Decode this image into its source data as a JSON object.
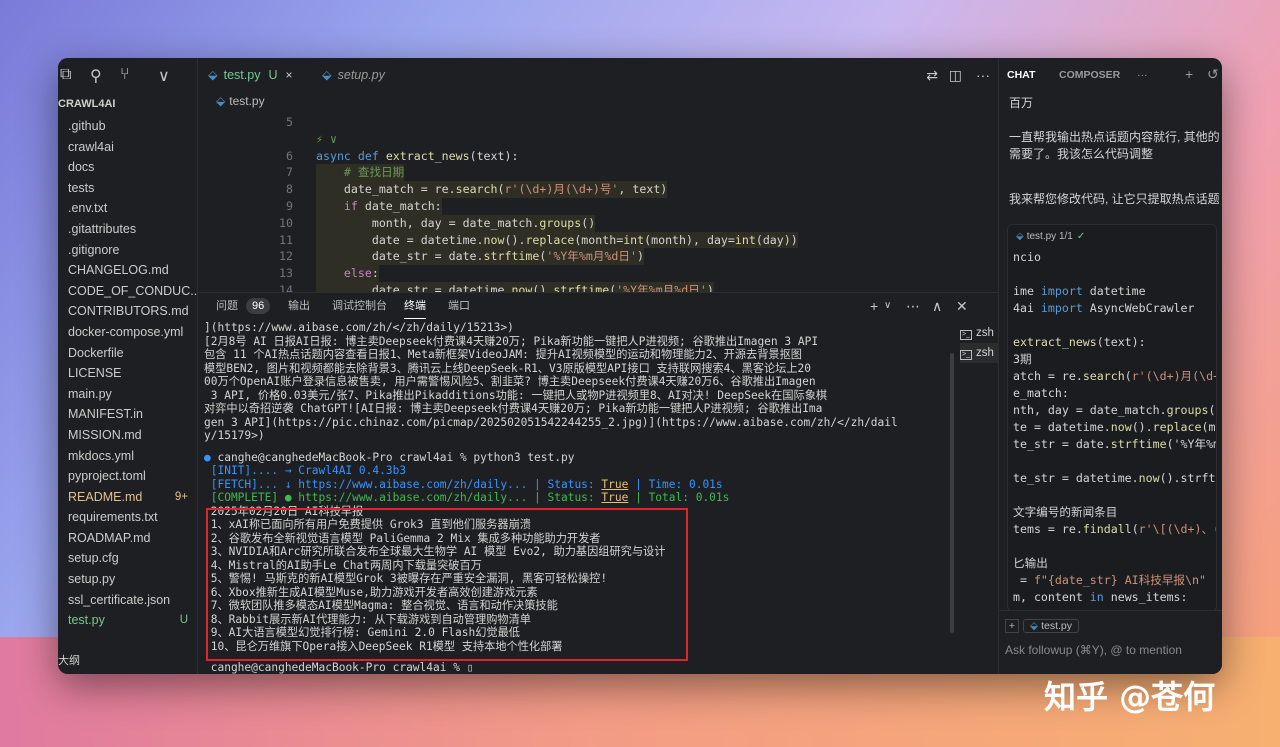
{
  "explorer": {
    "title": "CRAWL4AI",
    "items": [
      {
        "label": ".github",
        "badge": "",
        "state": ""
      },
      {
        "label": "crawl4ai",
        "badge": "",
        "state": ""
      },
      {
        "label": "docs",
        "badge": "",
        "state": ""
      },
      {
        "label": "tests",
        "badge": "",
        "state": ""
      },
      {
        "label": ".env.txt",
        "badge": "",
        "state": ""
      },
      {
        "label": ".gitattributes",
        "badge": "",
        "state": ""
      },
      {
        "label": ".gitignore",
        "badge": "",
        "state": ""
      },
      {
        "label": "CHANGELOG.md",
        "badge": "",
        "state": ""
      },
      {
        "label": "CODE_OF_CONDUC...",
        "badge": "",
        "state": ""
      },
      {
        "label": "CONTRIBUTORS.md",
        "badge": "",
        "state": ""
      },
      {
        "label": "docker-compose.yml",
        "badge": "",
        "state": ""
      },
      {
        "label": "Dockerfile",
        "badge": "",
        "state": ""
      },
      {
        "label": "LICENSE",
        "badge": "",
        "state": ""
      },
      {
        "label": "main.py",
        "badge": "",
        "state": ""
      },
      {
        "label": "MANIFEST.in",
        "badge": "",
        "state": ""
      },
      {
        "label": "MISSION.md",
        "badge": "",
        "state": ""
      },
      {
        "label": "mkdocs.yml",
        "badge": "",
        "state": ""
      },
      {
        "label": "pyproject.toml",
        "badge": "",
        "state": ""
      },
      {
        "label": "README.md",
        "badge": "9+",
        "state": "mod"
      },
      {
        "label": "requirements.txt",
        "badge": "",
        "state": ""
      },
      {
        "label": "ROADMAP.md",
        "badge": "",
        "state": ""
      },
      {
        "label": "setup.cfg",
        "badge": "",
        "state": ""
      },
      {
        "label": "setup.py",
        "badge": "",
        "state": ""
      },
      {
        "label": "ssl_certificate.json",
        "badge": "",
        "state": ""
      },
      {
        "label": "test.py",
        "badge": "U",
        "state": "sel"
      }
    ],
    "outline": "大纲"
  },
  "editor": {
    "tab1": {
      "label": "test.py",
      "badge": "U",
      "close": "×"
    },
    "tab2": {
      "label": "setup.py"
    },
    "breadcrumb": "test.py",
    "more": "···",
    "lines": [
      {
        "n": "5",
        "html": ""
      },
      {
        "n": "",
        "html": "<span class='cm'>⚡ ∨</span>"
      },
      {
        "n": "6",
        "html": "<span class='bl'>async</span> <span class='bl'>def</span> <span class='fn'>extract_news</span>(text):"
      },
      {
        "n": "7",
        "html": "    <span class='cm'># 查找日期</span>"
      },
      {
        "n": "8",
        "html": "    date_match = re.<span class='fn'>search</span>(<span class='st'>r'(\\d+)月(\\d+)号'</span>, text)"
      },
      {
        "n": "9",
        "html": "    <span class='kw'>if</span> date_match:"
      },
      {
        "n": "10",
        "html": "        month, day = date_match.<span class='fn'>groups</span>()"
      },
      {
        "n": "11",
        "html": "        date = datetime.<span class='fn'>now</span>().<span class='fn'>replace</span>(month=<span class='fn'>int</span>(month), day=<span class='fn'>int</span>(day))"
      },
      {
        "n": "12",
        "html": "        date_str = date.<span class='fn'>strftime</span>(<span class='st'>'%Y年%m月%d日'</span>)"
      },
      {
        "n": "13",
        "html": "    <span class='kw'>else</span>:"
      },
      {
        "n": "14",
        "html": "        date_str = datetime.<span class='fn'>now</span>().<span class='fn'>strftime</span>(<span class='st'>'%Y年%m月%d日'</span>)"
      }
    ]
  },
  "panel": {
    "tabs": [
      {
        "label": "问题",
        "count": "96"
      },
      {
        "label": "输出"
      },
      {
        "label": "调试控制台"
      },
      {
        "label": "终端",
        "active": true
      },
      {
        "label": "端口"
      }
    ],
    "terminals": [
      "zsh",
      "zsh"
    ],
    "terminal_lines": [
      "](https://www.aibase.com/zh/</zh/daily/15213>)",
      "[2月8号 AI 日报AI日报: 博主卖Deepseek付费课4天赚20万; Pika新功能一键把人P进视频; 谷歌推出Imagen 3 API",
      "包含 11 个AI热点话题内容查看日报1、Meta新框架VideoJAM: 提升AI视频模型的运动和物理能力2、开源去背景抠图",
      "模型BEN2, 图片和视频都能去除背景3、腾讯云上线DeepSeek-R1、V3原版模型API接口 支持联网搜索4、黑客论坛上20",
      "00万个OpenAI账户登录信息被售卖, 用户需警惕风险5、割韭菜? 博主卖Deepseek付费课4天赚20万6、谷歌推出Imagen",
      " 3 API, 价格0.03美元/张7、Pika推出Pikadditions功能: 一键把人或物P进视频里8、AI对决! DeepSeek在国际象棋",
      "对弈中以奇招逆袭 ChatGPT![AI日报: 博主卖Deepseek付费课4天赚20万; Pika新功能一键把人P进视频; 谷歌推出Ima",
      "gen 3 API](https://pic.chinaz.com/picmap/202502051542244255_2.jpg)](https://www.aibase.com/zh/</zh/dail",
      "y/15179>)"
    ],
    "prompt": "canghe@canghedeMacBook-Pro crawl4ai % python3 test.py",
    "init": "[INIT].... → Crawl4AI 0.4.3b3",
    "fetch": "[FETCH]... ↓ https://www.aibase.com/zh/daily... | Status: True | Time: 0.01s",
    "complete": "[COMPLETE] ● https://www.aibase.com/zh/daily... | Status: True | Total: 0.01s",
    "news_title": "2025年02月20日 AI科技早报",
    "news": [
      "1、xAI称已面向所有用户免费提供 Grok3 直到他们服务器崩溃",
      "2、谷歌发布全新视觉语言模型 PaliGemma 2 Mix 集成多种功能助力开发者",
      "3、NVIDIA和Arc研究所联合发布全球最大生物学 AI 模型 Evo2, 助力基因组研究与设计",
      "4、Mistral的AI助手Le Chat两周内下载量突破百万",
      "5、警惕! 马斯克的新AI模型Grok 3被曝存在严重安全漏洞, 黑客可轻松操控!",
      "6、Xbox推新生成AI模型Muse,助力游戏开发者高效创建游戏元素",
      "7、微软团队推多模态AI模型Magma: 整合视觉、语言和动作决策技能",
      "8、Rabbit展示新AI代理能力: 从下载游戏到自动管理购物清单",
      "9、AI大语言模型幻觉排行榜: Gemini 2.0 Flash幻觉最低",
      "10、昆仑万维旗下Opera接入DeepSeek R1模型 支持本地个性化部署"
    ],
    "last_prompt": "canghe@canghedeMacBook-Pro crawl4ai % ▯"
  },
  "chat": {
    "tab_chat": "CHAT",
    "tab_composer": "COMPOSER",
    "more": "···",
    "top_text": "百万",
    "user_line1": "一直帮我输出热点话题内容就行, 其他的",
    "user_line2": "需要了。我该怎么代码调整",
    "reply": "我来帮您修改代码, 让它只提取热点话题",
    "card_file": "test.py",
    "card_count": "1/1",
    "card_code": [
      "ncio",
      "",
      "ime import datetime",
      "4ai import AsyncWebCrawler",
      "",
      "extract_news(text):",
      "3期",
      "atch = re.search(r'(\\d+)月(\\d+)",
      "e_match:",
      "nth, day = date_match.groups()",
      "te = datetime.now().replace(mon",
      "te_str = date.strftime('%Y年%m月",
      "",
      "te_str = datetime.now().strftim",
      "",
      "文字编号的新闻条目",
      "tems = re.findall(r'\\[(\\d+)、(.",
      "",
      "匕输出",
      " = f\"{date_str} AI科技早报\\n\"",
      "m, content in news_items:"
    ],
    "input_chip": "test.py",
    "input_placeholder": "Ask followup (⌘Y), @ to mention"
  },
  "watermark": "知乎 @苍何"
}
